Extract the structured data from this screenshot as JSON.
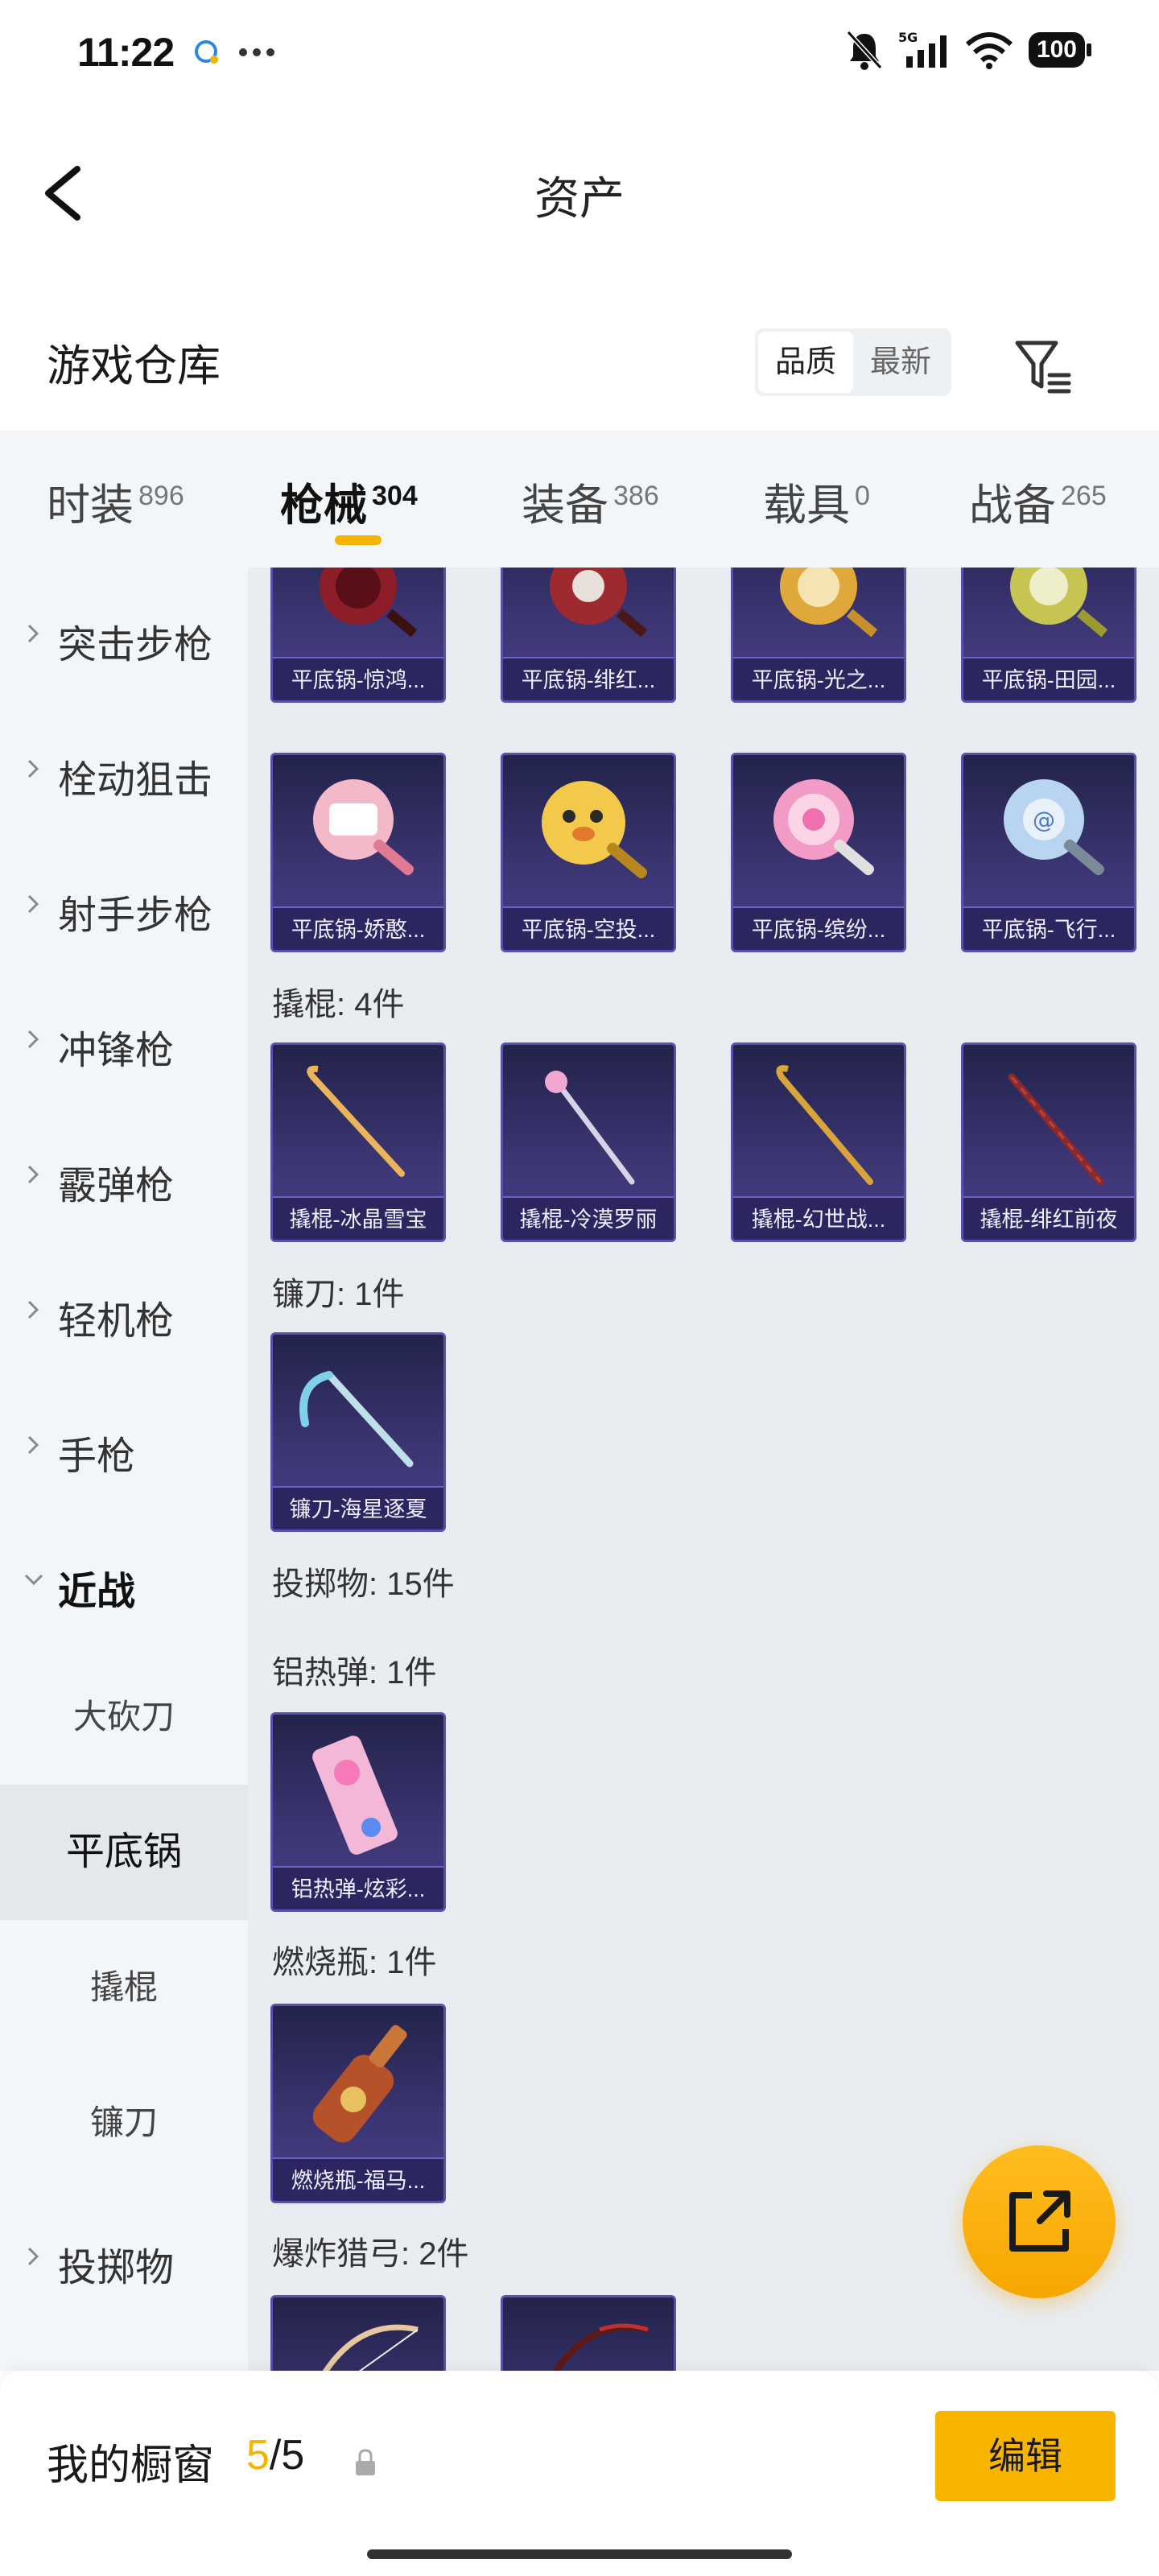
{
  "status_bar": {
    "time": "11:22",
    "battery": "100",
    "network": "5G"
  },
  "header": {
    "title": "资产"
  },
  "warehouse": {
    "title": "游戏仓库",
    "sort_options": [
      "品质",
      "最新"
    ],
    "active_sort": "品质"
  },
  "tabs": [
    {
      "label": "时装",
      "count": "896"
    },
    {
      "label": "枪械",
      "count": "304",
      "active": true
    },
    {
      "label": "装备",
      "count": "386"
    },
    {
      "label": "载具",
      "count": "0"
    },
    {
      "label": "战备",
      "count": "265"
    }
  ],
  "sidebar": {
    "items": [
      {
        "label": "突击步枪"
      },
      {
        "label": "栓动狙击"
      },
      {
        "label": "射手步枪"
      },
      {
        "label": "冲锋枪"
      },
      {
        "label": "霰弹枪"
      },
      {
        "label": "轻机枪"
      },
      {
        "label": "手枪"
      },
      {
        "label": "近战",
        "open": true
      },
      {
        "label": "投掷物"
      }
    ],
    "subitems": [
      {
        "label": "大砍刀"
      },
      {
        "label": "平底锅",
        "active": true
      },
      {
        "label": "撬棍"
      },
      {
        "label": "镰刀"
      }
    ]
  },
  "content": {
    "pan_row1": [
      "平底锅-惊鸿...",
      "平底锅-绯红...",
      "平底锅-光之...",
      "平底锅-田园..."
    ],
    "pan_row2": [
      "平底锅-娇憨...",
      "平底锅-空投...",
      "平底锅-缤纷...",
      "平底锅-飞行..."
    ],
    "crowbar_title": "撬棍: 4件",
    "crowbars": [
      "撬棍-冰晶雪宝",
      "撬棍-冷漠罗丽",
      "撬棍-幻世战...",
      "撬棍-绯红前夜"
    ],
    "sickle_title": "镰刀: 1件",
    "sickles": [
      "镰刀-海星逐夏"
    ],
    "throwables_title": "投掷物: 15件",
    "thermite_title": "铝热弹: 1件",
    "thermites": [
      "铝热弹-炫彩..."
    ],
    "molotov_title": "燃烧瓶: 1件",
    "molotovs": [
      "燃烧瓶-福马..."
    ],
    "bow_title": "爆炸猎弓: 2件"
  },
  "bottom_bar": {
    "title": "我的橱窗",
    "count_current": "5",
    "count_total": "/5",
    "edit_label": "编辑"
  },
  "colors": {
    "accent": "#f5b400",
    "card_bg": "#3a3470"
  },
  "icons": [
    "back-arrow-icon",
    "filter-icon",
    "chevron-right-icon",
    "chevron-down-icon",
    "share-icon",
    "lock-icon"
  ]
}
